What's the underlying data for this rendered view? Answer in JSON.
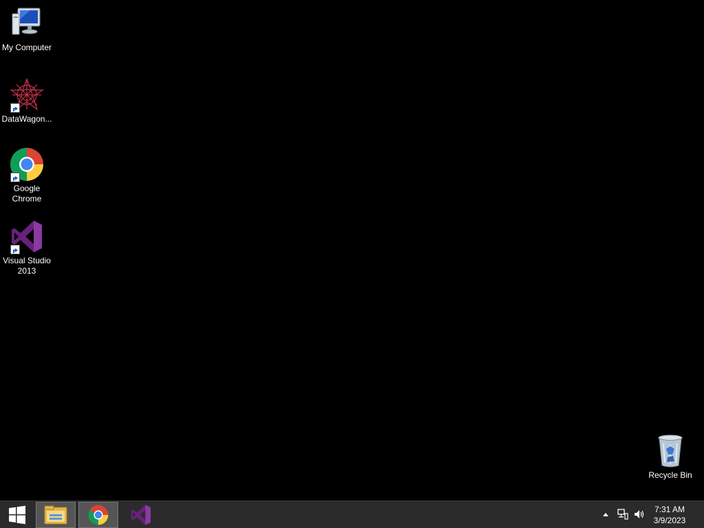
{
  "desktop": {
    "icons": [
      {
        "label": "My Computer",
        "icon": "computer-icon"
      },
      {
        "label": "DataWagon...",
        "icon": "datawagon-icon"
      },
      {
        "label": "Google\nChrome",
        "icon": "chrome-icon"
      },
      {
        "label": "Visual Studio\n2013",
        "icon": "visual-studio-icon"
      },
      {
        "label": "Recycle Bin",
        "icon": "recycle-bin-icon"
      }
    ]
  },
  "taskbar": {
    "start_icon": "windows-logo-icon",
    "pinned": [
      {
        "name": "File Explorer",
        "icon": "file-explorer-icon",
        "active": true
      },
      {
        "name": "Google Chrome",
        "icon": "chrome-icon",
        "active": true
      },
      {
        "name": "Visual Studio 2013",
        "icon": "visual-studio-icon",
        "active": false
      }
    ],
    "tray": {
      "icons": [
        "show-hidden-icons-arrow",
        "network-icon",
        "volume-icon"
      ],
      "time": "7:31 AM",
      "date": "3/9/2023"
    }
  },
  "colors": {
    "desktop_bg": "#000000",
    "taskbar_bg": "#2b2b2b",
    "vs_purple": "#68217a"
  }
}
